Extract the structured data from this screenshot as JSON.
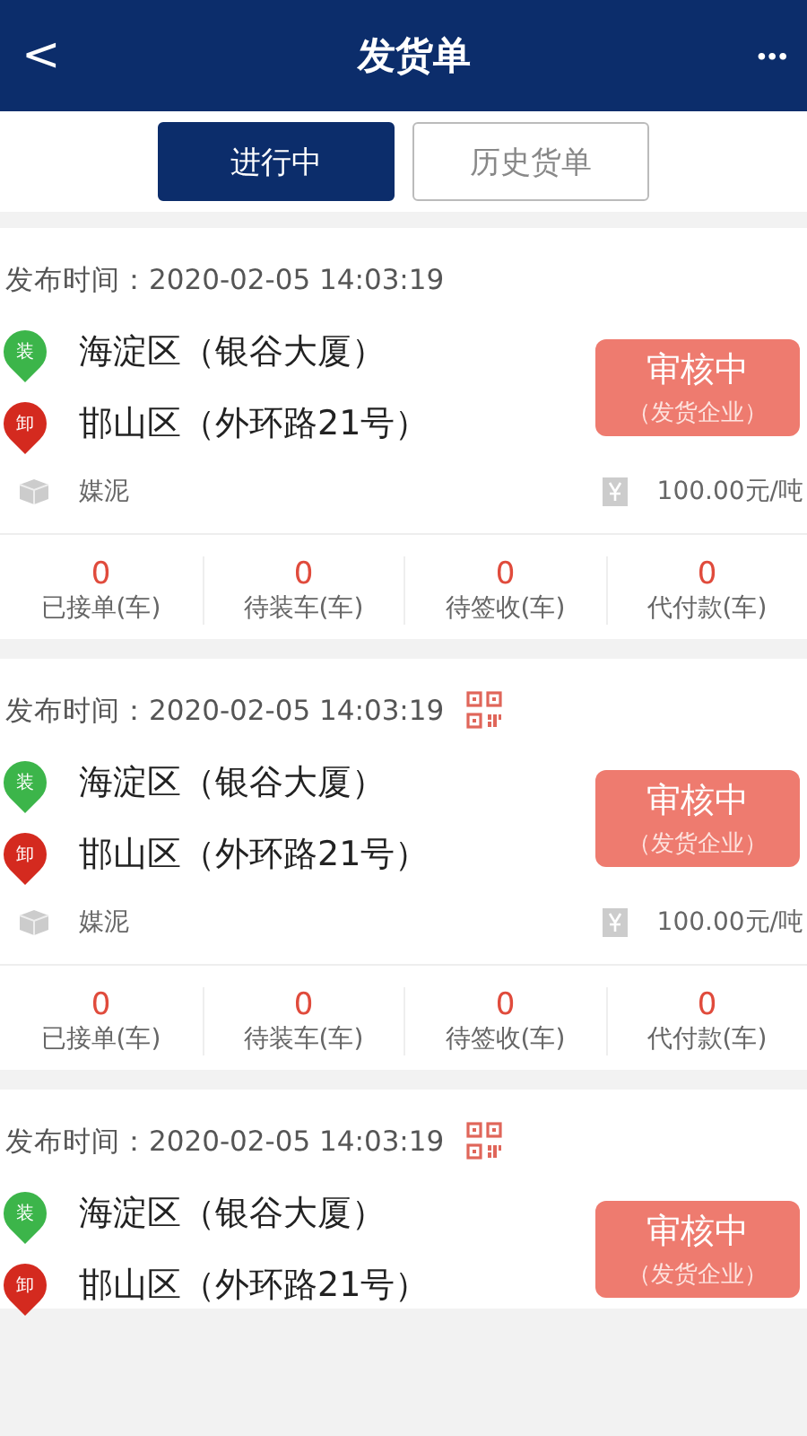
{
  "header": {
    "back": "<",
    "title": "发货单",
    "more": "•••"
  },
  "tabs": [
    {
      "label": "进行中",
      "selected": true
    },
    {
      "label": "历史货单",
      "selected": false
    }
  ],
  "orders": [
    {
      "time_label": "发布时间：",
      "time": "2020-02-05 14:03:19",
      "qr": false,
      "load": {
        "tag": "装",
        "address": "海淀区（银谷大厦）"
      },
      "unload": {
        "tag": "卸",
        "address": "邯山区（外环路21号）"
      },
      "status": "审核中",
      "status_note": "（发货企业）",
      "cargo": "媒泥",
      "price": "100.00元/吨",
      "stats": [
        {
          "value": "0",
          "label": "已接单(车)"
        },
        {
          "value": "0",
          "label": "待装车(车)"
        },
        {
          "value": "0",
          "label": "待签收(车)"
        },
        {
          "value": "0",
          "label": "代付款(车)"
        }
      ]
    },
    {
      "time_label": "发布时间：",
      "time": "2020-02-05 14:03:19",
      "qr": true,
      "load": {
        "tag": "装",
        "address": "海淀区（银谷大厦）"
      },
      "unload": {
        "tag": "卸",
        "address": "邯山区（外环路21号）"
      },
      "status": "审核中",
      "status_note": "（发货企业）",
      "cargo": "媒泥",
      "price": "100.00元/吨",
      "stats": [
        {
          "value": "0",
          "label": "已接单(车)"
        },
        {
          "value": "0",
          "label": "待装车(车)"
        },
        {
          "value": "0",
          "label": "待签收(车)"
        },
        {
          "value": "0",
          "label": "代付款(车)"
        }
      ]
    },
    {
      "time_label": "发布时间：",
      "time": "2020-02-05 14:03:19",
      "qr": true,
      "load": {
        "tag": "装",
        "address": "海淀区（银谷大厦）"
      },
      "unload": {
        "tag": "卸",
        "address": "邯山区（外环路21号）"
      },
      "status": "审核中",
      "status_note": "（发货企业）"
    }
  ]
}
